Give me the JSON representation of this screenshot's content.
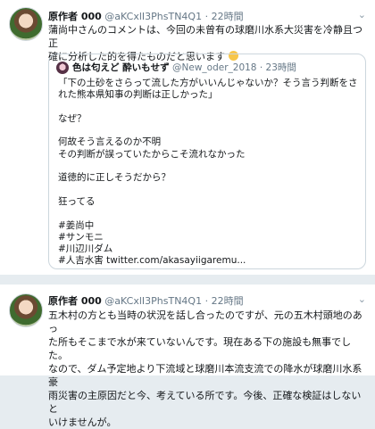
{
  "tweets": [
    {
      "name": "原作者 000",
      "handle": "@aKCxlI3PhsTN4Q1",
      "dot": "·",
      "time": "22時間",
      "text_lines": [
        "蒲尚中さんのコメントは、今回の未曾有の球磨川水系大災害を冷静且つ正",
        "確に分析した的を得たものだと思います"
      ],
      "emoji": "smiling-face-emoji",
      "quote": {
        "name": "色は匂えど 酔いもせず",
        "handle": "@New_oder_2018",
        "dot": "·",
        "time": "23時間",
        "lines": [
          "「下の土砂をさらって流した方がいいんじゃないか？そう言う判断をさ",
          "れた熊本県知事の判断は正しかった」",
          "",
          "なぜ？",
          "",
          "何故そう言えるのか不明",
          "その判断が誤っていたからこそ流れなかった",
          "",
          "道徳的に正しそうだから？",
          "",
          "狂ってる",
          "",
          "#姜尚中",
          "#サンモニ",
          "#川辺川ダム",
          "#人吉水害 twitter.com/akasayiigaremu..."
        ]
      }
    },
    {
      "name": "原作者 000",
      "handle": "@aKCxlI3PhsTN4Q1",
      "dot": "·",
      "time": "22時間",
      "text_lines": [
        "五木村の方とも当時の状況を話し合ったのですが、元の五木村頭地のあっ",
        "た所もそこまで水が来ていないんです。現在ある下の施設も無事でした。",
        "なので、ダム予定地より下流域と球磨川本流支流での降水が球磨川水系豪",
        "雨災害の主原因だと今、考えている所です。今後、正確な検証はしないと",
        "いけませんが。"
      ]
    }
  ],
  "icons": {
    "menu": "chevron-down-icon"
  }
}
